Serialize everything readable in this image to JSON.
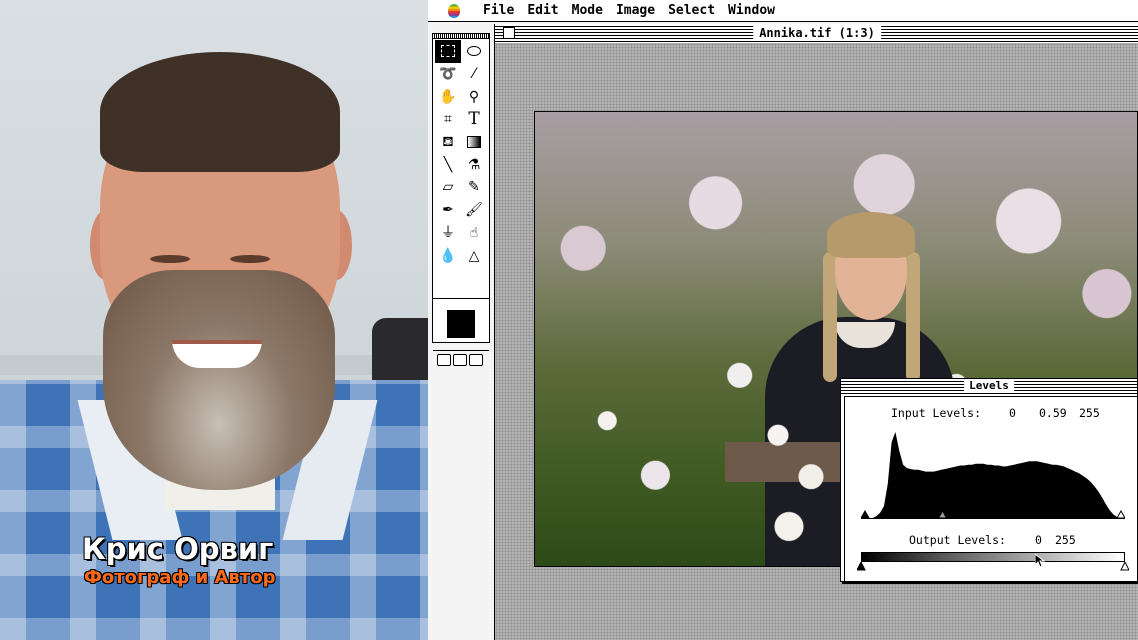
{
  "webcam": {
    "caption_name": "Крис Орвиг",
    "caption_role": "Фотограф и Автор",
    "colors": {
      "name": "#ffffff",
      "role": "#ff6a1a"
    }
  },
  "menubar": {
    "apple_icon": "apple-rainbow-icon",
    "items": [
      "File",
      "Edit",
      "Mode",
      "Image",
      "Select",
      "Window"
    ]
  },
  "document": {
    "title": "Annika.tif  (1:3)"
  },
  "toolbox": {
    "tools": [
      "marquee-rect-icon",
      "marquee-ellipse-icon",
      "lasso-icon",
      "magic-wand-icon",
      "hand-icon",
      "zoom-icon",
      "crop-icon",
      "type-icon",
      "paint-bucket-icon",
      "gradient-icon",
      "line-icon",
      "eyedropper-icon",
      "eraser-icon",
      "pencil-icon",
      "airbrush-icon",
      "paintbrush-icon",
      "rubber-stamp-icon",
      "smudge-icon",
      "blur-icon",
      "sharpen-icon"
    ],
    "selected_tool": "marquee-rect-icon",
    "foreground_color": "#000000"
  },
  "levels": {
    "title": "Levels",
    "input_label": "Input Levels:",
    "input_black": "0",
    "input_gamma": "0.59",
    "input_white": "255",
    "output_label": "Output Levels:",
    "output_black": "0",
    "output_white": "255",
    "histogram": [
      0,
      0,
      0,
      0,
      2,
      6,
      14,
      40,
      88,
      100,
      78,
      62,
      58,
      57,
      56,
      56,
      55,
      54,
      54,
      54,
      55,
      56,
      57,
      58,
      59,
      60,
      61,
      61,
      62,
      62,
      63,
      63,
      63,
      62,
      62,
      61,
      61,
      60,
      60,
      61,
      62,
      63,
      64,
      65,
      66,
      66,
      66,
      65,
      64,
      63,
      62,
      62,
      61,
      60,
      58,
      56,
      54,
      52,
      49,
      46,
      42,
      37,
      31,
      24,
      16,
      9,
      4,
      1,
      0,
      0
    ]
  }
}
